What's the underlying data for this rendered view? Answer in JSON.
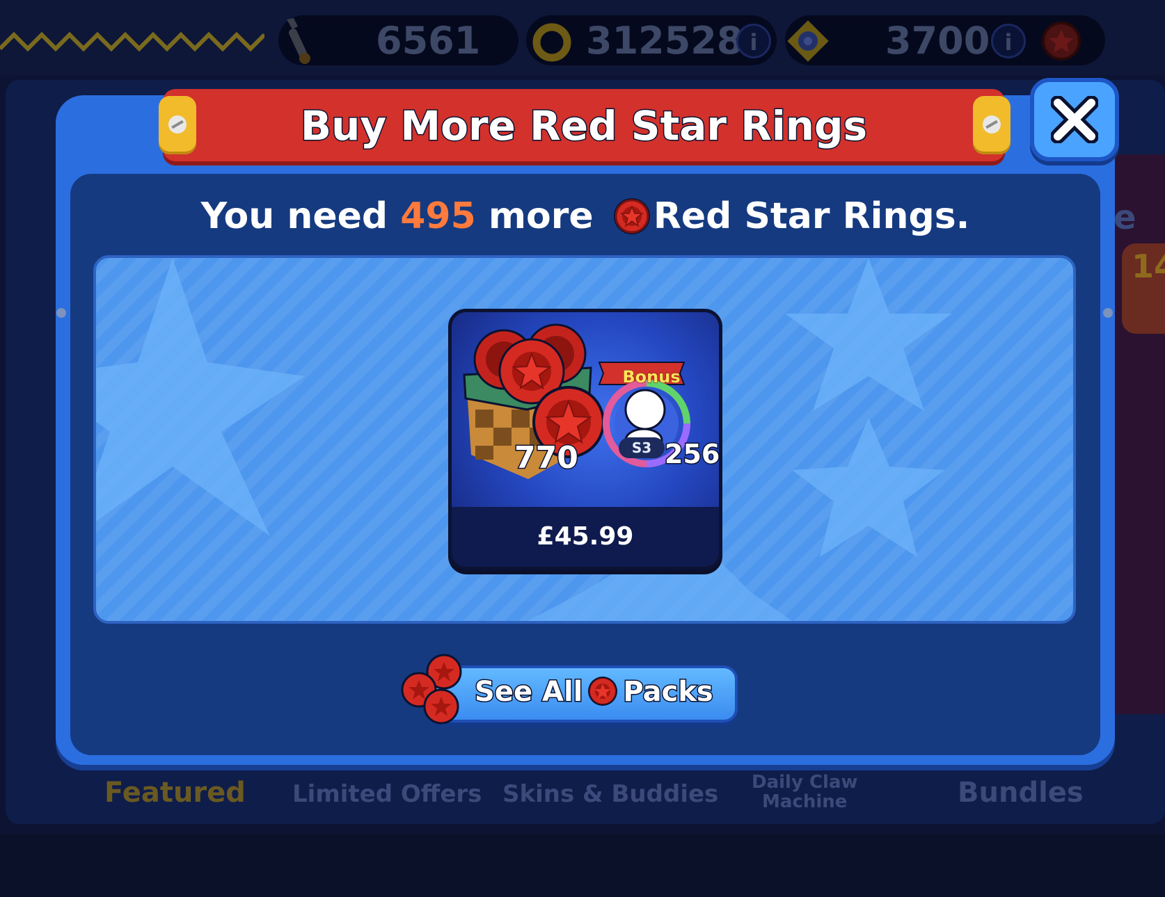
{
  "topbar": {
    "parts_value": "6561",
    "rings_value": "312528",
    "red_star_value": "3700",
    "info_label": "i"
  },
  "store": {
    "tabs": [
      "Featured",
      "Limited Offers",
      "Skins & Buddies",
      "Daily Claw Machine",
      "Bundles"
    ],
    "daily_claw_line1": "Daily Claw",
    "daily_claw_line2": "Machine",
    "partial_text": "e",
    "partial_badge": "14"
  },
  "modal": {
    "title": "Buy More Red Star Rings",
    "need_prefix": "You need",
    "need_amount": "495",
    "need_middle": "more",
    "need_suffix": "Red Star Rings.",
    "offer": {
      "quantity": "770",
      "bonus_label": "Bonus",
      "season": "S3",
      "bonus_quantity": "256",
      "price": "£45.99"
    },
    "see_all_prefix": "See All",
    "see_all_suffix": "Packs"
  },
  "colors": {
    "accent_number": "#ff7a3d",
    "title_banner": "#d2312c",
    "modal_frame": "#2b6ee0",
    "button": "#4aa3ff"
  },
  "icons": [
    "wrench-icon",
    "gold-ring-icon",
    "gear-token-icon",
    "red-star-ring-icon",
    "close-icon"
  ]
}
